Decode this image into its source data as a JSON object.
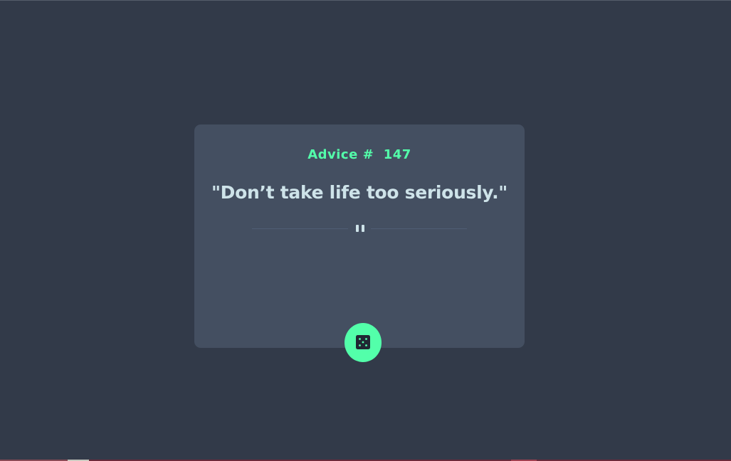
{
  "card": {
    "advice_label": "Advice #",
    "advice_number": "147",
    "quote": "\"Don’t take life too seriously.\""
  },
  "divider": {
    "icon": "pause-icon"
  },
  "dice_button": {
    "icon": "dice-icon"
  },
  "colors": {
    "background": "#323A49",
    "card": "#444F61",
    "accent": "#53FFAA",
    "text": "#CEE3E9",
    "divider": "#4F5D74"
  }
}
